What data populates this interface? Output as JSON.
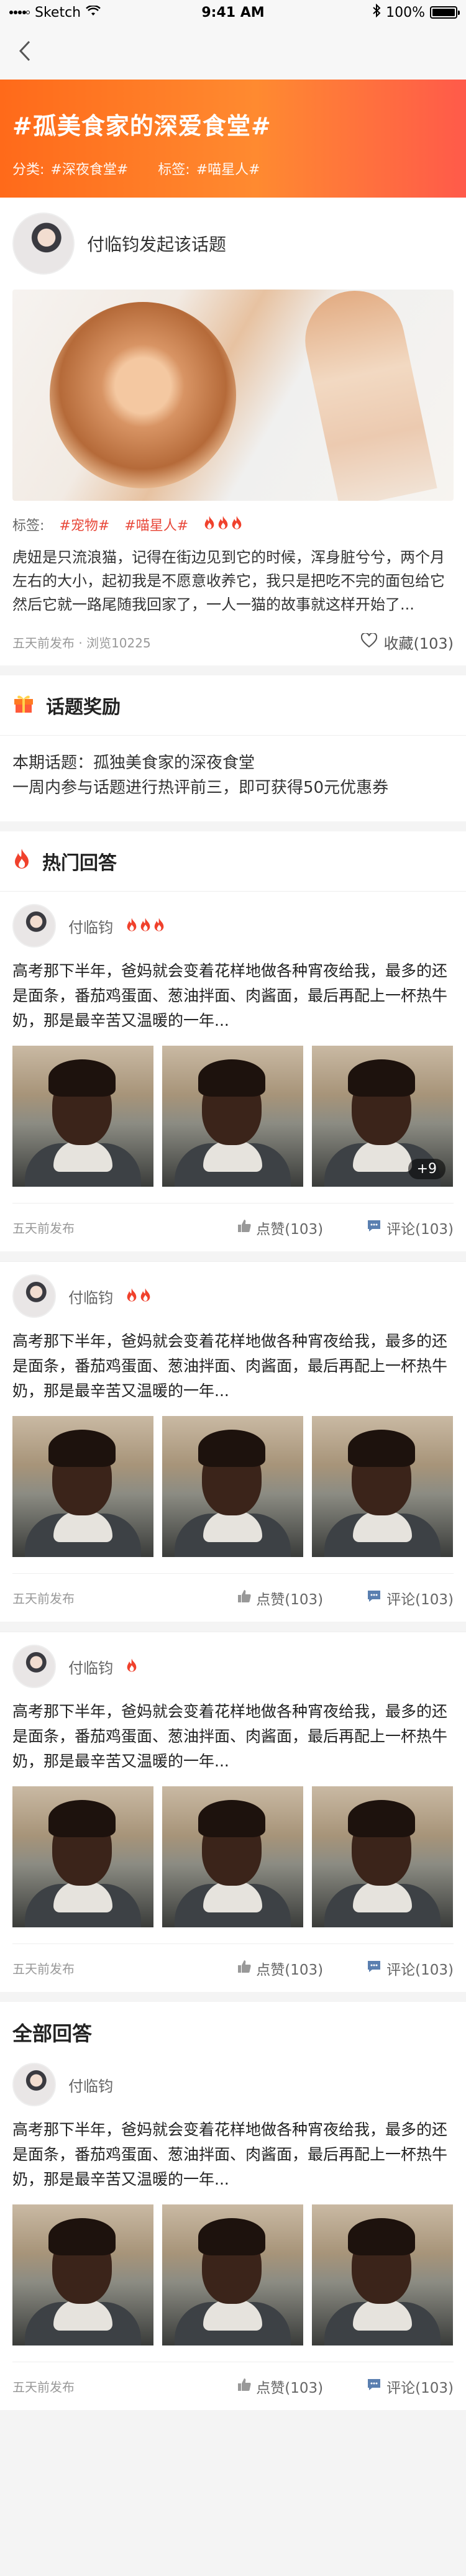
{
  "status_bar": {
    "carrier": "Sketch",
    "time": "9:41 AM",
    "battery": "100%",
    "battery_level": 1.0
  },
  "nav": {
    "back_icon": "chevron-left-icon"
  },
  "topic": {
    "title": "#孤美食家的深爱食堂#",
    "category_label": "分类:",
    "category_value": "#深夜食堂#",
    "tags_label": "标签:",
    "tags_value": "#喵星人#"
  },
  "post": {
    "author_text": "付临钧发起该话题",
    "tags_label": "标签:",
    "tags": [
      "#宠物#",
      "#喵星人#"
    ],
    "fire_count": 3,
    "text": "虎妞是只流浪猫，记得在街边见到它的时候，浑身脏兮兮，两个月左右的大小，起初我是不愿意收养它，我只是把吃不完的面包给它然后它就一路尾随我回家了，一人一猫的故事就这样开始了...",
    "meta": "五天前发布 · 浏览10225",
    "fav_label": "收藏(103)"
  },
  "reward": {
    "title": "话题奖励",
    "line1": "本期话题：孤独美食家的深夜食堂",
    "line2": "一周内参与话题进行热评前三，即可获得50元优惠券"
  },
  "hot": {
    "title": "热门回答",
    "answers": [
      {
        "name": "付临钧",
        "fires": 3,
        "text": "高考那下半年，爸妈就会变着花样地做各种宵夜给我，最多的还是面条，番茄鸡蛋面、葱油拌面、肉酱面，最后再配上一杯热牛奶，那是最辛苦又温暖的一年...",
        "more": "+9",
        "time": "五天前发布",
        "like": "点赞(103)",
        "comment": "评论(103)"
      },
      {
        "name": "付临钧",
        "fires": 2,
        "text": "高考那下半年，爸妈就会变着花样地做各种宵夜给我，最多的还是面条，番茄鸡蛋面、葱油拌面、肉酱面，最后再配上一杯热牛奶，那是最辛苦又温暖的一年...",
        "more": "",
        "time": "五天前发布",
        "like": "点赞(103)",
        "comment": "评论(103)"
      },
      {
        "name": "付临钧",
        "fires": 1,
        "text": "高考那下半年，爸妈就会变着花样地做各种宵夜给我，最多的还是面条，番茄鸡蛋面、葱油拌面、肉酱面，最后再配上一杯热牛奶，那是最辛苦又温暖的一年...",
        "more": "",
        "time": "五天前发布",
        "like": "点赞(103)",
        "comment": "评论(103)"
      }
    ]
  },
  "all": {
    "title": "全部回答",
    "answers": [
      {
        "name": "付临钧",
        "text": "高考那下半年，爸妈就会变着花样地做各种宵夜给我，最多的还是面条，番茄鸡蛋面、葱油拌面、肉酱面，最后再配上一杯热牛奶，那是最辛苦又温暖的一年...",
        "time": "五天前发布",
        "like": "点赞(103)",
        "comment": "评论(103)"
      }
    ]
  },
  "colors": {
    "accent_orange": "#ff7a22",
    "tag_red": "#e8483a",
    "fire_red": "#f0412c"
  }
}
